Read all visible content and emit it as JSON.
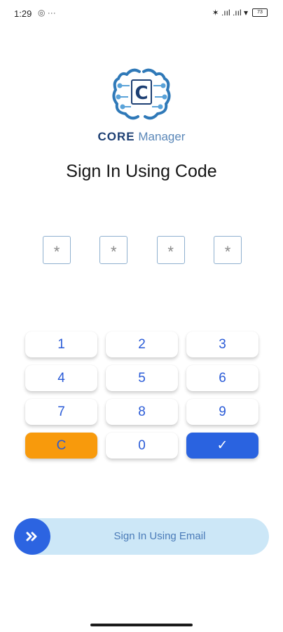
{
  "status": {
    "time": "1:29",
    "left_icons": "◎ ···",
    "right_icons": "✶ .ııl .ııl ▾",
    "battery": "73"
  },
  "brand": {
    "logo_letter": "C",
    "core": "CORE",
    "manager": "Manager"
  },
  "title": "Sign In Using Code",
  "pin_placeholders": [
    "*",
    "*",
    "*",
    "*"
  ],
  "keypad": {
    "k1": "1",
    "k2": "2",
    "k3": "3",
    "k4": "4",
    "k5": "5",
    "k6": "6",
    "k7": "7",
    "k8": "8",
    "k9": "9",
    "clear": "C",
    "k0": "0",
    "ok": "✓"
  },
  "email_button": {
    "label": "Sign In Using Email",
    "icon": "»"
  },
  "colors": {
    "accent_blue": "#2a63e0",
    "clear_orange": "#f89a0c",
    "email_bg": "#cce7f7",
    "brand_dark": "#1d3f73"
  }
}
